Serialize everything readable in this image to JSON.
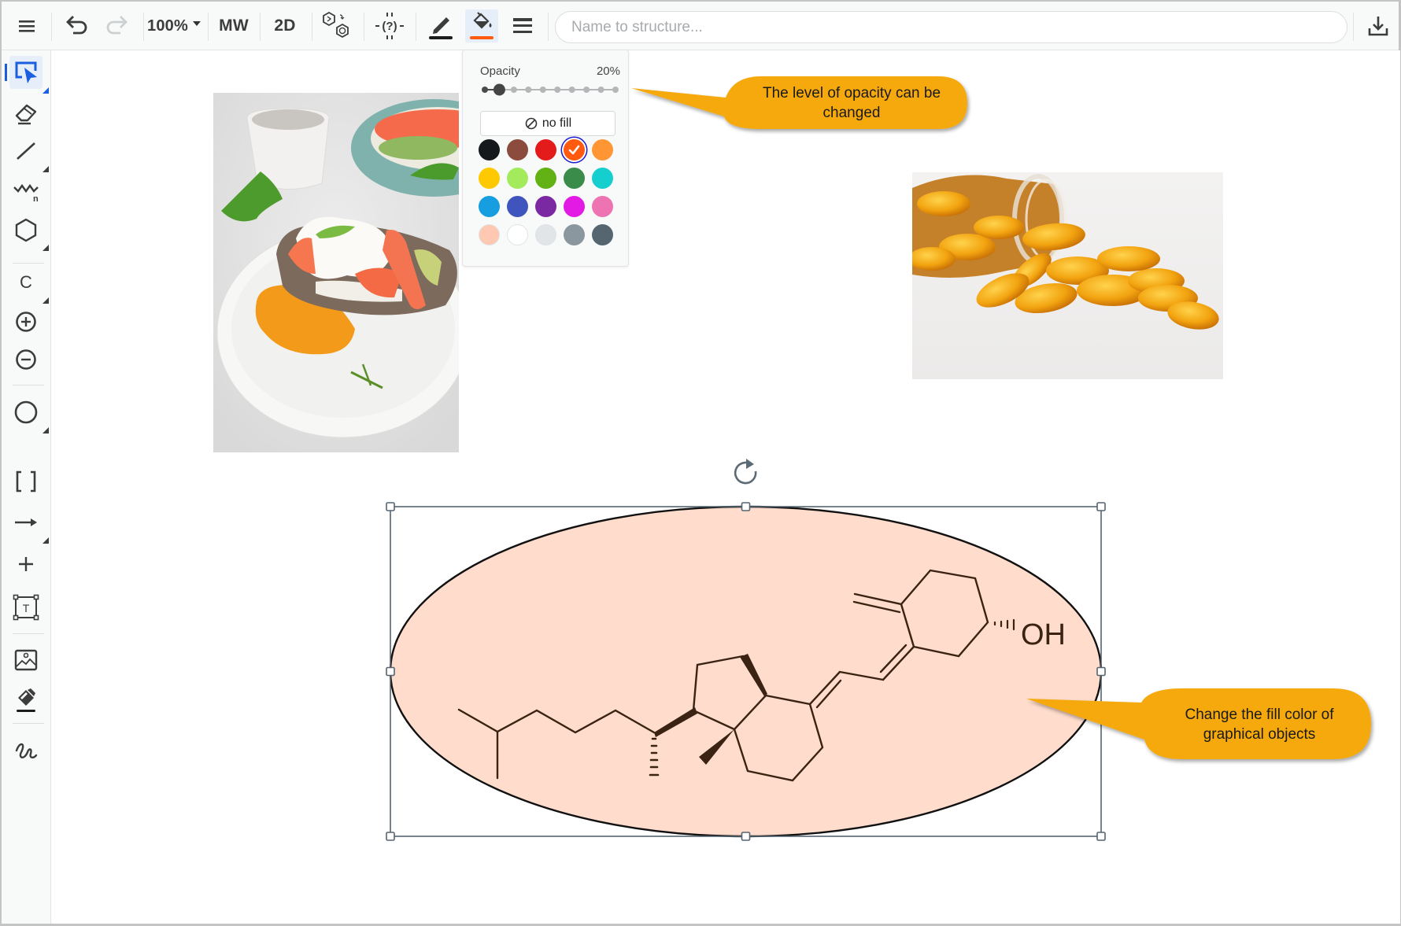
{
  "toolbar": {
    "menu_icon": "hamburger-icon",
    "undo_icon": "undo-icon",
    "redo_icon": "redo-icon",
    "zoom_level": "100%",
    "mw_label": "MW",
    "twod_label": "2D",
    "layout_icon": "structure-layout-icon",
    "query_icon": "query-atom-icon",
    "stroke_color_icon": "pen-icon",
    "fill_color_icon": "paint-bucket-icon",
    "line_style_icon": "line-style-icon",
    "name_placeholder": "Name to structure...",
    "name_value": "",
    "download_icon": "download-icon",
    "stroke_color": "#1a1c1e",
    "fill_color": "#ff5a10"
  },
  "sidebar": {
    "items": [
      {
        "name": "select-tool",
        "icon": "select-arrow-icon",
        "active": true
      },
      {
        "name": "eraser-tool",
        "icon": "eraser-icon"
      },
      {
        "name": "bond-tool",
        "icon": "single-bond-icon"
      },
      {
        "name": "chain-tool",
        "icon": "chain-icon",
        "subscript": "n"
      },
      {
        "name": "ring-tool",
        "icon": "hexagon-icon"
      },
      {
        "name": "atom-tool",
        "icon": "carbon-atom-icon",
        "label": "C"
      },
      {
        "name": "positive-charge-tool",
        "icon": "plus-circle-icon"
      },
      {
        "name": "negative-charge-tool",
        "icon": "minus-circle-icon"
      },
      {
        "name": "shape-tool",
        "icon": "circle-shape-icon"
      },
      {
        "name": "bracket-tool",
        "icon": "bracket-icon",
        "label": "[ ]"
      },
      {
        "name": "arrow-tool",
        "icon": "arrow-icon"
      },
      {
        "name": "plus-tool",
        "icon": "plus-icon"
      },
      {
        "name": "text-tool",
        "icon": "text-box-icon",
        "label": "T"
      },
      {
        "name": "image-tool",
        "icon": "image-icon"
      },
      {
        "name": "format-painter-tool",
        "icon": "format-brush-icon"
      },
      {
        "name": "freehand-tool",
        "icon": "freehand-icon"
      }
    ]
  },
  "fill_popup": {
    "opacity_label": "Opacity",
    "opacity_value": "20%",
    "opacity_fraction": 0.2,
    "opacity_steps": 10,
    "no_fill_label": "no fill",
    "no_fill_icon": "no-fill-icon",
    "selected_color": "#ff5a10",
    "swatches": [
      [
        "#16191b",
        "#8b4b3d",
        "#e31b1b",
        "#ff5a10",
        "#ff9633"
      ],
      [
        "#fec900",
        "#a3eb5d",
        "#62b216",
        "#3a8c4a",
        "#15cfcf"
      ],
      [
        "#169ee0",
        "#3f55bd",
        "#7b29a3",
        "#e31ae3",
        "#ee73b2"
      ],
      [
        "#ffc8b2",
        "#ffffff",
        "#e1e5e8",
        "#8a979e",
        "#566670"
      ]
    ]
  },
  "canvas": {
    "images": [
      {
        "name": "food-photo",
        "description": "poached egg salmon toast"
      },
      {
        "name": "pills-photo",
        "description": "spilled golden capsules"
      }
    ],
    "shape": {
      "type": "ellipse",
      "fill": "#ffdccc",
      "stroke": "#111111",
      "selected": true,
      "rotate_icon": "rotate-icon"
    },
    "molecule": {
      "label_OH": "OH",
      "bond_color": "#3b2314"
    }
  },
  "callouts": [
    {
      "text_line1": "The level of opacity can be",
      "text_line2": "changed",
      "color": "#f5a90d"
    },
    {
      "text_line1": "Change the fill color of",
      "text_line2": "graphical objects",
      "color": "#f5a90d"
    }
  ]
}
